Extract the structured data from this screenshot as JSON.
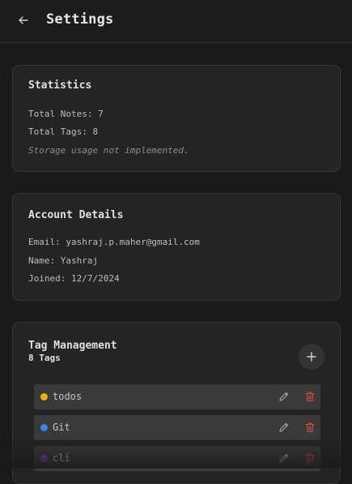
{
  "header": {
    "title": "Settings",
    "back_icon": "arrow-left-icon"
  },
  "statistics": {
    "title": "Statistics",
    "total_notes": "Total Notes: 7",
    "total_tags": "Total Tags: 8",
    "storage_note": "Storage usage not implemented."
  },
  "account": {
    "title": "Account Details",
    "email": "Email: yashraj.p.maher@gmail.com",
    "name": "Name: Yashraj",
    "joined": "Joined: 12/7/2024"
  },
  "tags_card": {
    "title": "Tag Management",
    "count": "8 Tags",
    "add_icon": "plus-icon",
    "items": [
      {
        "label": "todos",
        "color": "#eab308"
      },
      {
        "label": "Git",
        "color": "#3b82f6"
      },
      {
        "label": "cli",
        "color": "#7e3bbf"
      }
    ]
  },
  "colors": {
    "background": "#1a1a1a",
    "card": "#242424",
    "delete": "#e04848"
  }
}
